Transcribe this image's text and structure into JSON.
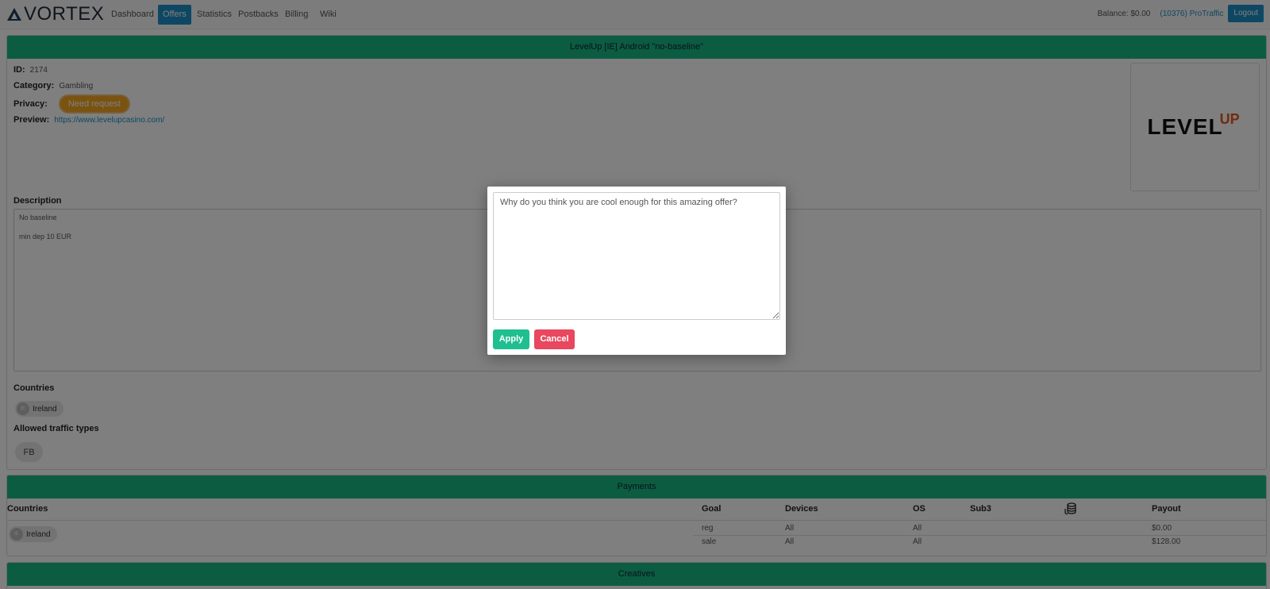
{
  "navbar": {
    "brand": "VORTEX",
    "items": [
      "Dashboard",
      "Offers",
      "Statistics",
      "Postbacks",
      "Billing",
      "Wiki"
    ],
    "active": "Offers",
    "balance": "Balance: $0.00",
    "user": "(10376) ProTraffic",
    "logout": "Logout"
  },
  "offer": {
    "title": "LevelUp [IE] Android \"no-baseline\"",
    "id_label": "ID:",
    "id": "2174",
    "category_label": "Category:",
    "category": "Gambling",
    "privacy_label": "Privacy:",
    "privacy": "Need request",
    "preview_label": "Preview:",
    "preview": "https://www.levelupcasino.com/",
    "logo_main": "LEVEL",
    "logo_accent": "UP",
    "description_label": "Description",
    "description_lines": [
      "No baseline",
      "min dep 10 EUR"
    ],
    "countries_label": "Countries",
    "country": "Ireland",
    "country_code": "IE",
    "traffic_label": "Allowed traffic types",
    "traffic": "FB"
  },
  "payments": {
    "title": "Payments",
    "columns": {
      "countries": "Countries",
      "goal": "Goal",
      "devices": "Devices",
      "os": "OS",
      "sub3": "Sub3",
      "payout": "Payout"
    },
    "country": "Ireland",
    "country_code": "IE",
    "rows": [
      {
        "goal": "reg",
        "devices": "All",
        "os": "All",
        "payout": "$0.00"
      },
      {
        "goal": "sale",
        "devices": "All",
        "os": "All",
        "payout": "$128.00"
      }
    ]
  },
  "creatives": {
    "title": "Creatives"
  },
  "modal": {
    "placeholder": "Why do you think you are cool enough for this amazing offer?",
    "apply": "Apply",
    "cancel": "Cancel"
  },
  "colors": {
    "accent": "#1c8fc6",
    "panel_header": "#18b885",
    "apply": "#1fbf8f",
    "cancel": "#e8475f",
    "privacy": "#f5a623"
  },
  "icons": {
    "brand": "triangle-logo-icon",
    "payout_header": "coins-icon"
  }
}
